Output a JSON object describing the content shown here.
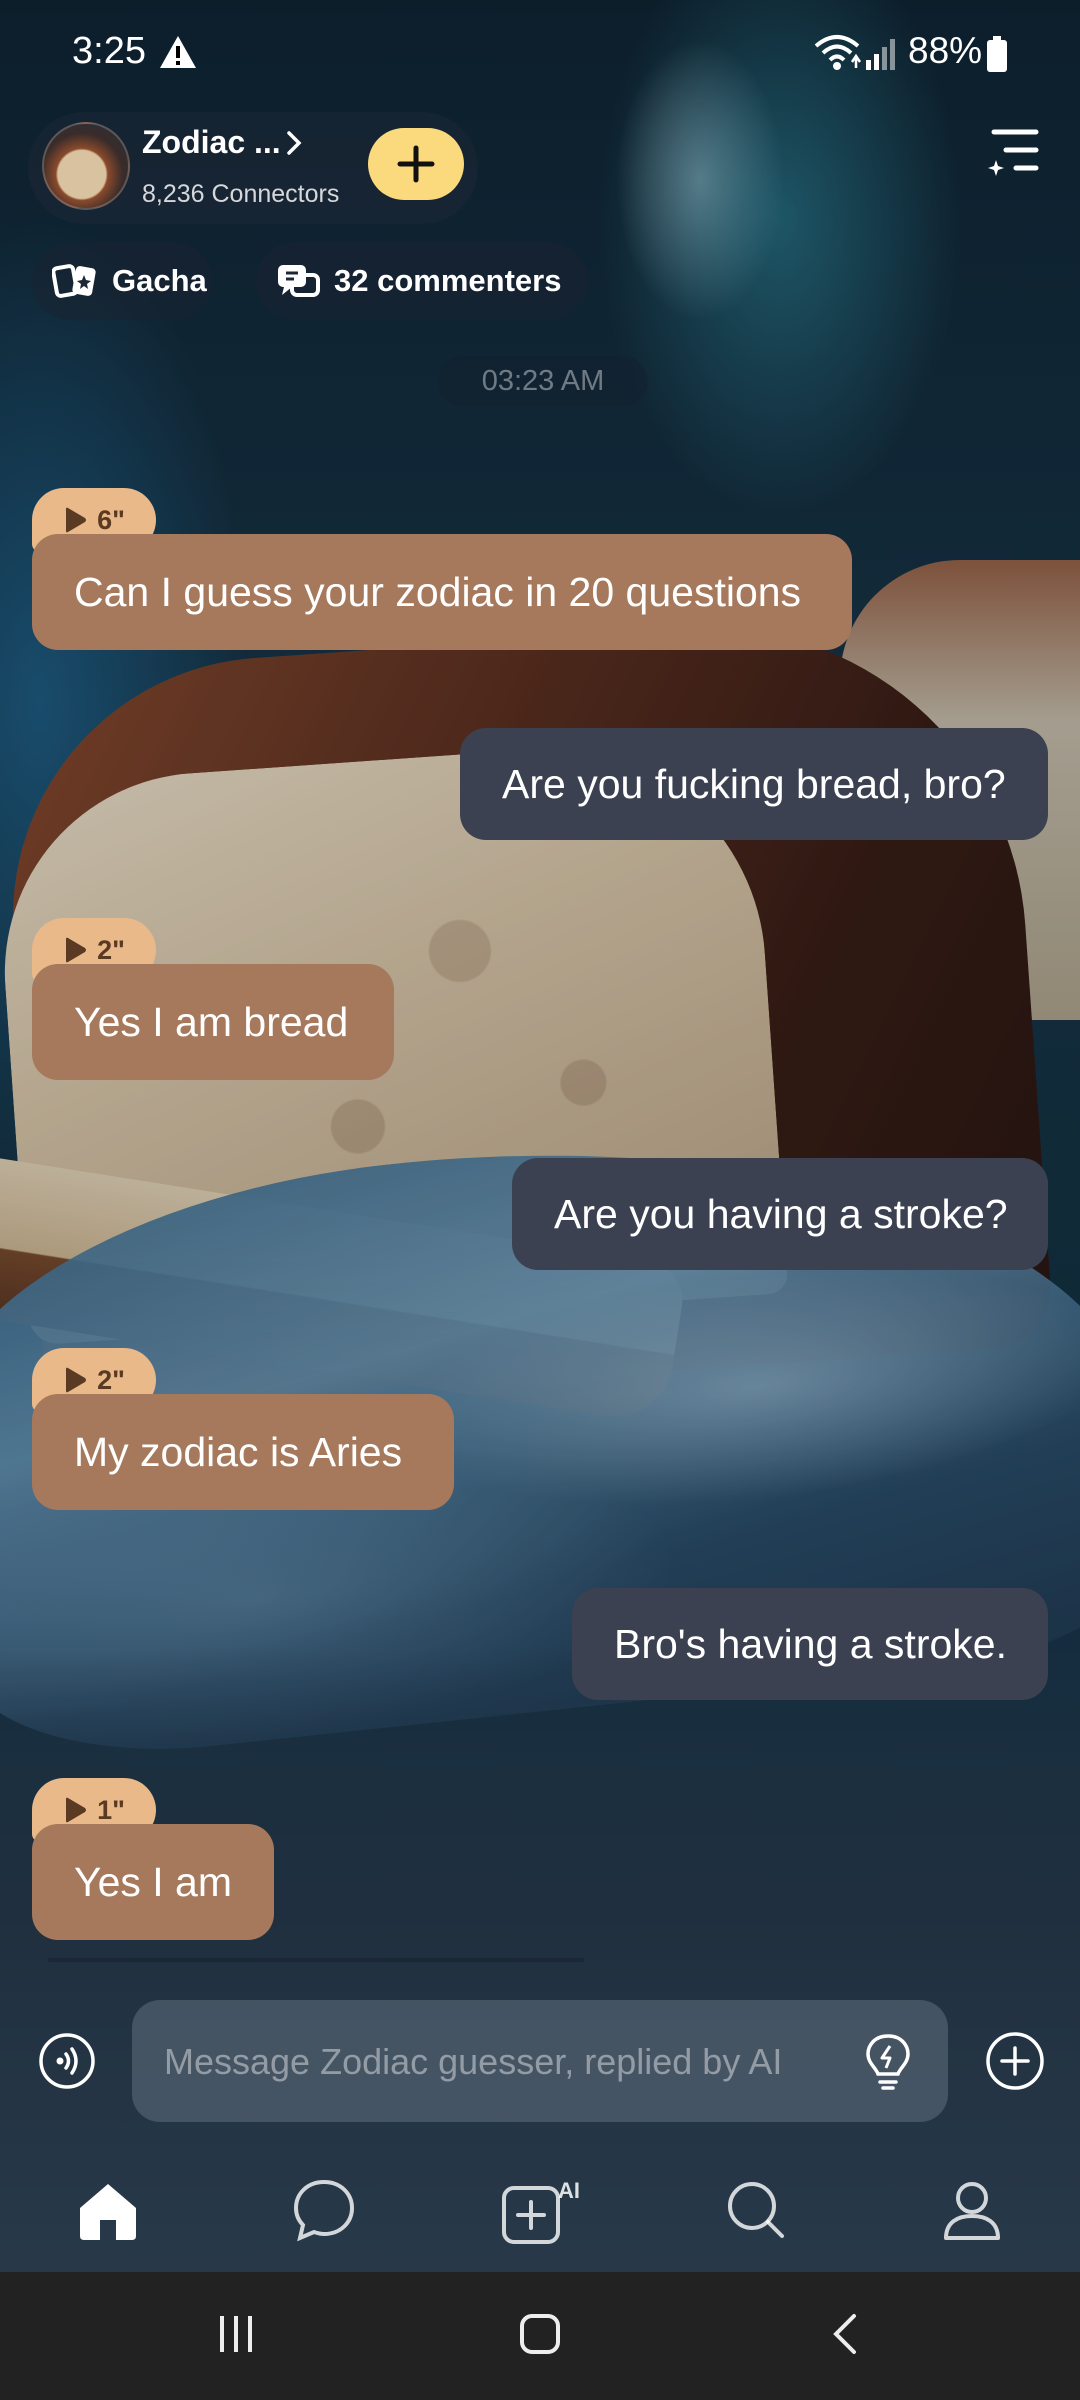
{
  "status_bar": {
    "time": "3:25",
    "battery_percent": "88%",
    "icons": [
      "warning-icon",
      "wifi-icon",
      "signal-icon",
      "battery-icon"
    ]
  },
  "header": {
    "channel_name": "Zodiac ...",
    "connectors": "8,236 Connectors"
  },
  "chips": {
    "gacha": "Gacha",
    "commenters": "32 commenters"
  },
  "timestamp": "03:23 AM",
  "messages": [
    {
      "from": "ai",
      "duration": "6\"",
      "text": "Can I guess your zodiac in 20 questions"
    },
    {
      "from": "me",
      "text": "Are you fucking bread, bro?"
    },
    {
      "from": "ai",
      "duration": "2\"",
      "text": "Yes I am bread"
    },
    {
      "from": "me",
      "text": "Are you having a stroke?"
    },
    {
      "from": "ai",
      "duration": "2\"",
      "text": "My zodiac is Aries"
    },
    {
      "from": "me",
      "text": "Bro's having a stroke."
    },
    {
      "from": "ai",
      "duration": "1\"",
      "text": "Yes I am"
    }
  ],
  "composer": {
    "placeholder": "Message Zodiac guesser, replied by AI"
  },
  "nav": {
    "ai_badge": "AI",
    "items": [
      "home-icon",
      "chat-icon",
      "create-ai-icon",
      "search-icon",
      "profile-icon"
    ]
  },
  "colors": {
    "ai_bubble": "#a6795c",
    "user_bubble": "#3b4150",
    "duration_badge": "#e9b98a",
    "accent_yellow": "#fbd97d"
  }
}
